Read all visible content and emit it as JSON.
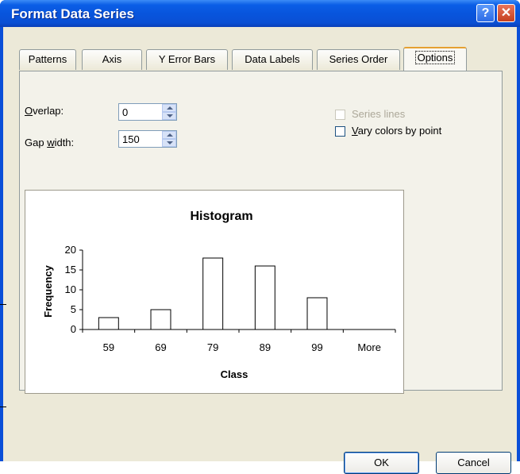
{
  "window": {
    "title": "Format Data Series",
    "help_label": "?",
    "close_label": "✕"
  },
  "tabs": [
    {
      "label": "Patterns",
      "active": false
    },
    {
      "label": "Axis",
      "active": false
    },
    {
      "label": "Y Error Bars",
      "active": false
    },
    {
      "label": "Data Labels",
      "active": false
    },
    {
      "label": "Series Order",
      "active": false
    },
    {
      "label": "Options",
      "active": true
    }
  ],
  "options": {
    "overlap": {
      "label_key": "O",
      "label_rest": "verlap:",
      "value": "0"
    },
    "gap_width": {
      "label_pre": "Gap ",
      "label_key": "w",
      "label_rest": "idth:",
      "value": "150"
    },
    "series_lines": {
      "label": "Series lines",
      "checked": false,
      "enabled": false
    },
    "vary_colors": {
      "label_key": "V",
      "label_rest": "ary colors by point",
      "checked": false,
      "enabled": true
    }
  },
  "chart_data": {
    "type": "bar",
    "title": "Histogram",
    "xlabel": "Class",
    "ylabel": "Frequency",
    "categories": [
      "59",
      "69",
      "79",
      "89",
      "99",
      "More"
    ],
    "values": [
      3,
      5,
      18,
      16,
      8,
      0
    ],
    "ylim": [
      0,
      20
    ],
    "yticks": [
      "0",
      "5",
      "10",
      "15",
      "20"
    ],
    "grid": false,
    "bar_fill": "#ffffff",
    "bar_stroke": "#000000"
  },
  "buttons": {
    "ok": "OK",
    "cancel": "Cancel"
  },
  "colors": {
    "titlebar": "#0855dd",
    "dialog_bg": "#ece9d8",
    "active_tab_accent": "#e5a032"
  }
}
